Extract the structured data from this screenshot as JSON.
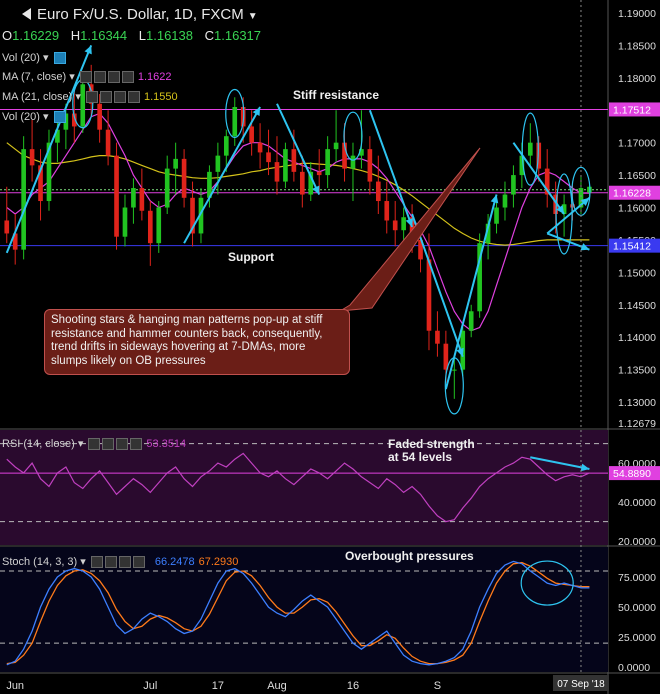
{
  "header": {
    "title": "Euro Fx/U.S. Dollar, 1D, FXCM",
    "ohlc": [
      {
        "k": "O",
        "v": "1.16229"
      },
      {
        "k": "H",
        "v": "1.16344"
      },
      {
        "k": "L",
        "v": "1.16138"
      },
      {
        "k": "C",
        "v": "1.16317"
      }
    ]
  },
  "legends": {
    "vol_top": "Vol (20)",
    "ma7": "MA (7, close)",
    "ma7_value": "1.1622",
    "ma21": "MA (21, close)",
    "ma21_value": "1.1550",
    "vol_bottom": "Vol (20)",
    "rsi": "RSI (14, close)",
    "rsi_value": "53.3514",
    "stoch": "Stoch (14, 3, 3)",
    "stoch_k_value": "66.2478",
    "stoch_d_value": "67.2930"
  },
  "annotations": {
    "stiff_resistance": "Stiff resistance",
    "support": "Support",
    "box": "Shooting stars & hanging man patterns pop-up at stiff resistance and hammer counters back, consequently, trend drifts in sideways hovering at 7-DMAs, more slumps likely on OB pressures",
    "rsi_note_1": "Faded strength",
    "rsi_note_2": "at 54 levels",
    "stoch_note": "Overbought pressures"
  },
  "colors": {
    "up": "#21c421",
    "down": "#e0241b",
    "ma7": "#e040e0",
    "ma21": "#d4c21a",
    "level": "#e040e0",
    "support_line": "#3a3af0",
    "rsi": "#c040c0",
    "stoch_k": "#3d7fff",
    "stoch_d": "#ff7a1a",
    "arrow": "#2ec4f0"
  },
  "chart_data": [
    {
      "type": "candlestick",
      "x_tick_labels": [
        "Jun",
        "Jul",
        "17",
        "Aug",
        "16",
        "S"
      ],
      "x_current_label": "07 Sep '18",
      "y_ticks": [
        "1.19000",
        "1.18500",
        "1.18000",
        "1.17500",
        "1.17000",
        "1.16500",
        "1.16000",
        "1.15500",
        "1.15000",
        "1.14500",
        "1.14000",
        "1.13500",
        "1.13000",
        "1.12679"
      ],
      "ylim": [
        1.126,
        1.192
      ],
      "price_labels": [
        {
          "label": "1.17512",
          "value": 1.17512,
          "role": "resistance"
        },
        {
          "label": "1.16228",
          "value": 1.16228,
          "role": "current"
        },
        {
          "label": "1.15412",
          "value": 1.15412,
          "role": "support"
        }
      ],
      "candles": [
        [
          1.158,
          1.1632,
          1.1545,
          1.156
        ],
        [
          1.156,
          1.159,
          1.1512,
          1.1535
        ],
        [
          1.1535,
          1.171,
          1.152,
          1.169
        ],
        [
          1.169,
          1.1735,
          1.164,
          1.1665
        ],
        [
          1.1665,
          1.169,
          1.158,
          1.161
        ],
        [
          1.161,
          1.172,
          1.1595,
          1.17
        ],
        [
          1.17,
          1.1745,
          1.167,
          1.172
        ],
        [
          1.172,
          1.176,
          1.169,
          1.1745
        ],
        [
          1.1745,
          1.178,
          1.17,
          1.1725
        ],
        [
          1.1725,
          1.18,
          1.1715,
          1.179
        ],
        [
          1.179,
          1.182,
          1.174,
          1.176
        ],
        [
          1.176,
          1.1775,
          1.17,
          1.172
        ],
        [
          1.172,
          1.175,
          1.1665,
          1.168
        ],
        [
          1.168,
          1.17,
          1.1535,
          1.1555
        ],
        [
          1.1555,
          1.162,
          1.154,
          1.16
        ],
        [
          1.16,
          1.1645,
          1.1575,
          1.163
        ],
        [
          1.163,
          1.166,
          1.158,
          1.1595
        ],
        [
          1.1595,
          1.161,
          1.151,
          1.1545
        ],
        [
          1.1545,
          1.161,
          1.153,
          1.16
        ],
        [
          1.16,
          1.168,
          1.159,
          1.166
        ],
        [
          1.166,
          1.17,
          1.162,
          1.1675
        ],
        [
          1.1675,
          1.169,
          1.16,
          1.1615
        ],
        [
          1.1615,
          1.164,
          1.154,
          1.156
        ],
        [
          1.156,
          1.163,
          1.1545,
          1.1615
        ],
        [
          1.1615,
          1.1665,
          1.16,
          1.1655
        ],
        [
          1.1655,
          1.17,
          1.162,
          1.168
        ],
        [
          1.168,
          1.172,
          1.1655,
          1.171
        ],
        [
          1.171,
          1.177,
          1.1695,
          1.1755
        ],
        [
          1.1755,
          1.177,
          1.17,
          1.1725
        ],
        [
          1.1725,
          1.175,
          1.168,
          1.17
        ],
        [
          1.17,
          1.173,
          1.166,
          1.1685
        ],
        [
          1.1685,
          1.172,
          1.165,
          1.167
        ],
        [
          1.167,
          1.171,
          1.162,
          1.164
        ],
        [
          1.164,
          1.17,
          1.163,
          1.169
        ],
        [
          1.169,
          1.172,
          1.164,
          1.1655
        ],
        [
          1.1655,
          1.168,
          1.16,
          1.162
        ],
        [
          1.162,
          1.167,
          1.161,
          1.1655
        ],
        [
          1.1655,
          1.169,
          1.162,
          1.165
        ],
        [
          1.165,
          1.171,
          1.163,
          1.169
        ],
        [
          1.169,
          1.175,
          1.167,
          1.17
        ],
        [
          1.17,
          1.173,
          1.164,
          1.166
        ],
        [
          1.166,
          1.17,
          1.161,
          1.168
        ],
        [
          1.168,
          1.175,
          1.166,
          1.169
        ],
        [
          1.169,
          1.171,
          1.162,
          1.164
        ],
        [
          1.164,
          1.168,
          1.159,
          1.161
        ],
        [
          1.161,
          1.164,
          1.156,
          1.158
        ],
        [
          1.158,
          1.161,
          1.154,
          1.1565
        ],
        [
          1.1565,
          1.16,
          1.154,
          1.1585
        ],
        [
          1.1585,
          1.1605,
          1.153,
          1.155
        ],
        [
          1.155,
          1.158,
          1.15,
          1.152
        ],
        [
          1.152,
          1.156,
          1.138,
          1.141
        ],
        [
          1.141,
          1.144,
          1.137,
          1.139
        ],
        [
          1.139,
          1.141,
          1.133,
          1.135
        ],
        [
          1.135,
          1.137,
          1.1305,
          1.135
        ],
        [
          1.135,
          1.142,
          1.134,
          1.141
        ],
        [
          1.141,
          1.145,
          1.14,
          1.144
        ],
        [
          1.144,
          1.156,
          1.143,
          1.1545
        ],
        [
          1.1545,
          1.159,
          1.152,
          1.1575
        ],
        [
          1.1575,
          1.162,
          1.156,
          1.16
        ],
        [
          1.16,
          1.164,
          1.158,
          1.162
        ],
        [
          1.162,
          1.1665,
          1.16,
          1.165
        ],
        [
          1.165,
          1.17,
          1.163,
          1.168
        ],
        [
          1.168,
          1.173,
          1.1665,
          1.17
        ],
        [
          1.17,
          1.171,
          1.164,
          1.166
        ],
        [
          1.166,
          1.169,
          1.16,
          1.162
        ],
        [
          1.162,
          1.164,
          1.156,
          1.159
        ],
        [
          1.159,
          1.162,
          1.1555,
          1.1605
        ],
        [
          1.1605,
          1.164,
          1.158,
          1.16
        ],
        [
          1.16,
          1.165,
          1.159,
          1.163
        ],
        [
          1.1623,
          1.1634,
          1.1614,
          1.1632
        ]
      ],
      "ma7": [
        1.16,
        1.159,
        1.16,
        1.162,
        1.163,
        1.164,
        1.166,
        1.168,
        1.17,
        1.172,
        1.174,
        1.1745,
        1.173,
        1.1705,
        1.168,
        1.165,
        1.163,
        1.161,
        1.16,
        1.1605,
        1.162,
        1.163,
        1.1625,
        1.162,
        1.1625,
        1.164,
        1.166,
        1.168,
        1.1695,
        1.17,
        1.17,
        1.1695,
        1.1685,
        1.1675,
        1.167,
        1.1665,
        1.166,
        1.1655,
        1.166,
        1.167,
        1.1675,
        1.1675,
        1.1675,
        1.167,
        1.166,
        1.1645,
        1.1625,
        1.1605,
        1.1585,
        1.1565,
        1.154,
        1.1505,
        1.147,
        1.144,
        1.142,
        1.141,
        1.1415,
        1.144,
        1.148,
        1.152,
        1.156,
        1.16,
        1.163,
        1.165,
        1.1655,
        1.165,
        1.164,
        1.163,
        1.1622,
        1.1622
      ],
      "ma21": [
        1.17,
        1.169,
        1.168,
        1.1675,
        1.167,
        1.1668,
        1.1668,
        1.167,
        1.1672,
        1.1675,
        1.1678,
        1.168,
        1.168,
        1.1678,
        1.1675,
        1.167,
        1.1665,
        1.166,
        1.1655,
        1.1652,
        1.165,
        1.1648,
        1.1646,
        1.1645,
        1.1645,
        1.1646,
        1.1648,
        1.165,
        1.1652,
        1.1655,
        1.1657,
        1.166,
        1.1662,
        1.1664,
        1.1666,
        1.1668,
        1.1668,
        1.1667,
        1.1666,
        1.1665,
        1.1663,
        1.166,
        1.1657,
        1.1653,
        1.1648,
        1.1642,
        1.1635,
        1.1627,
        1.1618,
        1.1608,
        1.1598,
        1.1588,
        1.1578,
        1.1568,
        1.156,
        1.1553,
        1.1548,
        1.1545,
        1.1543,
        1.1542,
        1.1543,
        1.1545,
        1.1547,
        1.1549,
        1.155,
        1.155,
        1.155,
        1.155,
        1.155,
        1.155
      ],
      "levels": {
        "resistance": 1.17512,
        "current": 1.16228,
        "support": 1.15412
      }
    },
    {
      "type": "line",
      "name": "RSI (14, close)",
      "y_ticks": [
        "60.0000",
        "40.0000",
        "20.0000"
      ],
      "current_label": "54.8890",
      "ylim": [
        18,
        77
      ],
      "bands": [
        70,
        30
      ],
      "values": [
        62,
        58,
        55,
        60,
        52,
        48,
        55,
        58,
        50,
        47,
        52,
        56,
        50,
        44,
        48,
        52,
        49,
        45,
        50,
        55,
        58,
        52,
        48,
        53,
        56,
        60,
        58,
        62,
        65,
        60,
        55,
        53,
        56,
        52,
        49,
        53,
        57,
        55,
        52,
        56,
        60,
        57,
        53,
        50,
        47,
        52,
        49,
        45,
        48,
        44,
        38,
        33,
        30,
        31,
        37,
        42,
        48,
        52,
        55,
        58,
        60,
        63,
        62,
        58,
        54,
        51,
        53,
        54,
        53,
        55
      ],
      "level_line": 54.889
    },
    {
      "type": "line",
      "name": "Stoch (14, 3, 3)",
      "y_ticks": [
        "75.0000",
        "50.0000",
        "25.0000",
        "0.0000"
      ],
      "ylim": [
        -4,
        100
      ],
      "bands": [
        80,
        20
      ],
      "series": [
        {
          "name": "%K",
          "values": [
            2,
            5,
            15,
            30,
            50,
            65,
            75,
            80,
            82,
            80,
            75,
            65,
            50,
            35,
            28,
            32,
            40,
            45,
            42,
            38,
            32,
            28,
            30,
            40,
            55,
            70,
            80,
            82,
            78,
            70,
            60,
            50,
            45,
            42,
            48,
            55,
            60,
            55,
            50,
            40,
            30,
            20,
            15,
            20,
            25,
            30,
            20,
            10,
            5,
            3,
            2,
            3,
            5,
            8,
            15,
            30,
            50,
            65,
            78,
            85,
            88,
            86,
            80,
            75,
            70,
            68,
            70,
            68,
            66,
            66
          ]
        },
        {
          "name": "%D",
          "values": [
            3,
            4,
            10,
            20,
            38,
            55,
            68,
            76,
            80,
            81,
            78,
            72,
            62,
            48,
            38,
            32,
            34,
            40,
            43,
            41,
            37,
            32,
            30,
            34,
            44,
            58,
            72,
            79,
            80,
            76,
            68,
            58,
            50,
            45,
            45,
            50,
            56,
            57,
            54,
            46,
            36,
            26,
            18,
            18,
            22,
            27,
            24,
            16,
            9,
            5,
            3,
            3,
            4,
            6,
            10,
            20,
            38,
            55,
            70,
            80,
            86,
            87,
            84,
            79,
            74,
            70,
            69,
            68,
            67,
            67
          ]
        }
      ]
    }
  ]
}
